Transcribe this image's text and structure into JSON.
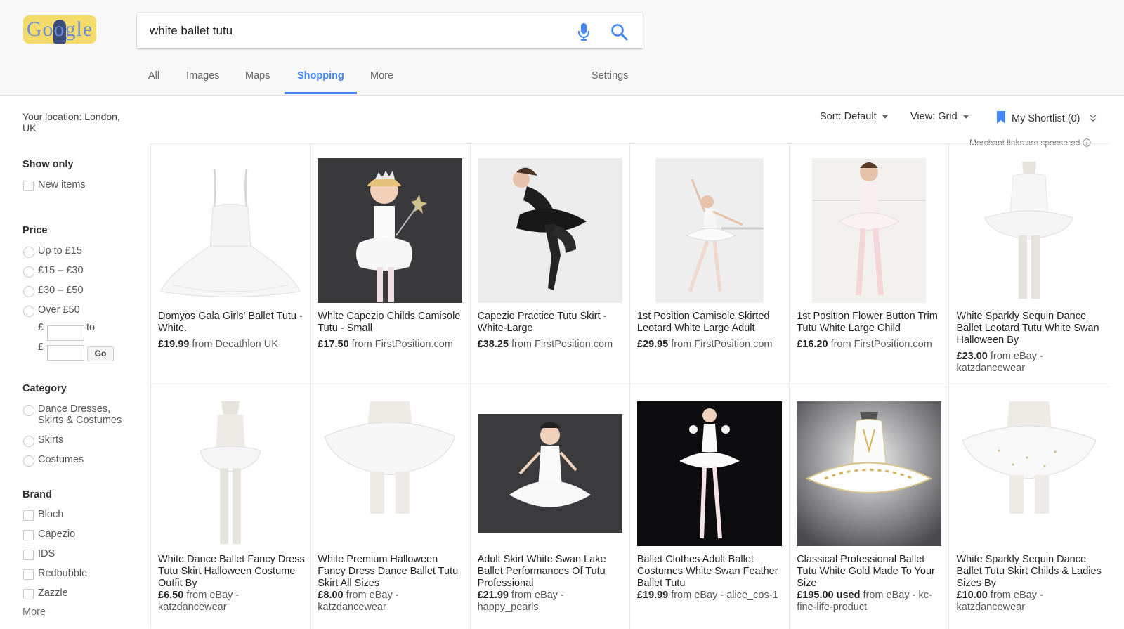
{
  "search": {
    "query": "white ballet tutu"
  },
  "logo": {
    "text": "Google"
  },
  "tabs": [
    {
      "label": "All"
    },
    {
      "label": "Images"
    },
    {
      "label": "Maps"
    },
    {
      "label": "Shopping"
    },
    {
      "label": "More"
    },
    {
      "label": "Settings"
    }
  ],
  "sidebar": {
    "location": "Your location: London, UK",
    "show_only": {
      "heading": "Show only",
      "items": [
        "New items"
      ]
    },
    "price": {
      "heading": "Price",
      "options": [
        "Up to £15",
        "£15 – £30",
        "£30 – £50",
        "Over £50"
      ],
      "currency": "£",
      "to_label": "to",
      "go_label": "Go"
    },
    "category": {
      "heading": "Category",
      "options": [
        "Dance Dresses, Skirts & Costumes",
        "Skirts",
        "Costumes"
      ]
    },
    "brand": {
      "heading": "Brand",
      "options": [
        "Bloch",
        "Capezio",
        "IDS",
        "Redbubble",
        "Zazzle"
      ]
    },
    "more": "More"
  },
  "toolbar": {
    "sort_label": "Sort:",
    "sort_value": "Default",
    "view_label": "View:",
    "view_value": "Grid",
    "shortlist": "My Shortlist (0)",
    "sponsored": "Merchant links are sponsored"
  },
  "products": [
    {
      "title": "Domyos Gala Girls' Ballet Tutu - White.",
      "price": "£19.99",
      "tag": "",
      "from": " from Decathlon UK"
    },
    {
      "title": "White Capezio Childs Camisole Tutu - Small",
      "price": "£17.50",
      "tag": "",
      "from": " from FirstPosition.com"
    },
    {
      "title": "Capezio Practice Tutu Skirt - White-Large",
      "price": "£38.25",
      "tag": "",
      "from": " from FirstPosition.com"
    },
    {
      "title": "1st Position Camisole Skirted Leotard White Large Adult",
      "price": "£29.95",
      "tag": "",
      "from": " from FirstPosition.com"
    },
    {
      "title": "1st Position Flower Button Trim Tutu White Large Child",
      "price": "£16.20",
      "tag": "",
      "from": " from FirstPosition.com"
    },
    {
      "title": "White Sparkly Sequin Dance Ballet Leotard Tutu White Swan Halloween By",
      "price": "£23.00",
      "tag": "",
      "from": " from eBay - katzdancewear"
    },
    {
      "title": "White Dance Ballet Fancy Dress Tutu Skirt Halloween Costume Outfit By",
      "price": "£6.50",
      "tag": "",
      "from": " from eBay - katzdancewear"
    },
    {
      "title": "White Premium Halloween Fancy Dress Dance Ballet Tutu Skirt All Sizes",
      "price": "£8.00",
      "tag": "",
      "from": " from eBay - katzdancewear"
    },
    {
      "title": "Adult Skirt White Swan Lake Ballet Performances Of Tutu Professional",
      "price": "£21.99",
      "tag": "",
      "from": " from eBay - happy_pearls"
    },
    {
      "title": "Ballet Clothes Adult Ballet Costumes White Swan Feather Ballet Tutu",
      "price": "£19.99",
      "tag": "",
      "from": " from eBay - alice_cos-1"
    },
    {
      "title": "Classical Professional Ballet Tutu White Gold Made To Your Size",
      "price": "£195.00",
      "tag": " used",
      "from": " from eBay - kc-fine-life-product"
    },
    {
      "title": "White Sparkly Sequin Dance Ballet Tutu Skirt Childs & Ladies Sizes By",
      "price": "£10.00",
      "tag": "",
      "from": " from eBay - katzdancewear"
    }
  ],
  "colors": {
    "accent": "#4285f4",
    "header_bg": "#f8f8f8",
    "border": "#e6e6e6"
  }
}
